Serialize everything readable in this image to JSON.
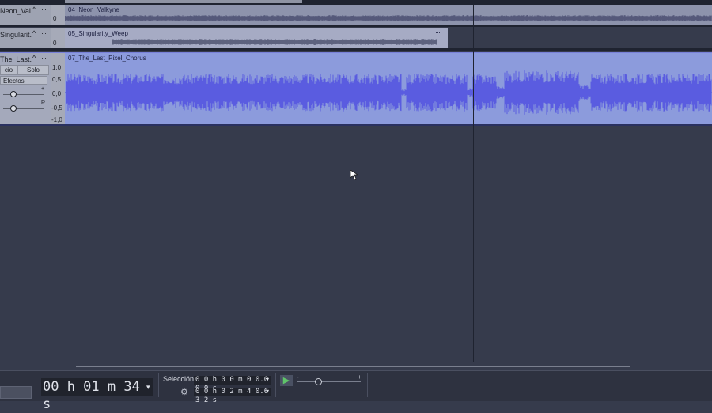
{
  "tracks": {
    "t04": {
      "name": "Neon_Val...",
      "clip_title": "04_Neon_Valkyne",
      "scale": "0"
    },
    "t05": {
      "name": "Singularit...",
      "clip_title": "05_Singularity_Weep",
      "scale": "0"
    },
    "t07": {
      "name": "The_Last...",
      "clip_title": "07_The_Last_Pixel_Chorus",
      "mute_label": "cio",
      "solo_label": "Solo",
      "effects_label": "Efectos",
      "gain_plus": "+",
      "pan_right": "R",
      "scale_ticks": [
        "1,0",
        "0,5",
        "0,0",
        "-0,5",
        "-1,0"
      ]
    }
  },
  "icons": {
    "collapse": "^",
    "menu": "···",
    "clip_menu": "···",
    "play": "▶",
    "gear": "⚙",
    "dropdown": "▾"
  },
  "toolbar": {
    "time": "00 h 01 m 34 s",
    "selection_label": "Selección",
    "selection_start": "0 0 h 0 0 m 0 0.0 0 0 s",
    "selection_end": "0 0 h 0 2 m 4 0.6 3 2 s",
    "speed_minus": "-",
    "speed_plus": "+"
  },
  "colors": {
    "background": "#363b4c",
    "waveform": "#5a5ce0",
    "clip_selected": "#8c9bdc",
    "play_green": "#5fc46a"
  }
}
